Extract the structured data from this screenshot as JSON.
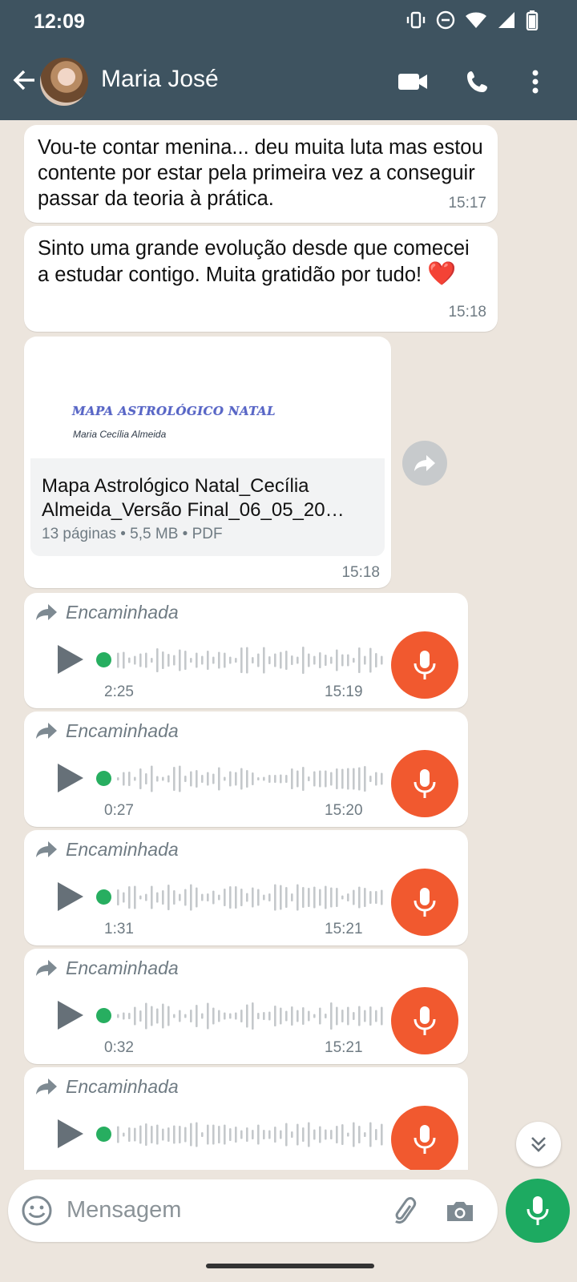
{
  "status": {
    "time": "12:09"
  },
  "header": {
    "contact_name": "Maria José"
  },
  "messages": [
    {
      "text": "Vou-te contar menina... deu muita luta mas estou contente por estar pela primeira vez a conseguir passar da teoria à prática.",
      "time": "15:17"
    },
    {
      "text": "Sinto uma grande evolução desde que comecei a estudar contigo. Muita gratidão por tudo!",
      "emoji": "❤️",
      "time": "15:18"
    }
  ],
  "document": {
    "preview_title": "MAPA ASTROLÓGICO NATAL",
    "preview_subtitle": "Maria Cecília Almeida",
    "name_line1": "Mapa Astrológico Natal_Cecília",
    "name_line2": "Almeida_Versão Final_06_05_20…",
    "meta": "13 páginas • 5,5 MB • PDF",
    "time": "15:18"
  },
  "voice_messages": [
    {
      "forwarded_label": "Encaminhada",
      "duration": "2:25",
      "time": "15:19"
    },
    {
      "forwarded_label": "Encaminhada",
      "duration": "0:27",
      "time": "15:20"
    },
    {
      "forwarded_label": "Encaminhada",
      "duration": "1:31",
      "time": "15:21"
    },
    {
      "forwarded_label": "Encaminhada",
      "duration": "0:32",
      "time": "15:21"
    },
    {
      "forwarded_label": "Encaminhada",
      "duration": "",
      "time": ""
    }
  ],
  "input": {
    "placeholder": "Mensagem"
  },
  "colors": {
    "header": "#3E5360",
    "chat_bg": "#ECE5DD",
    "voice_mic": "#F1592F",
    "send_mic": "#1DAA61",
    "play_dot": "#27AE60"
  }
}
